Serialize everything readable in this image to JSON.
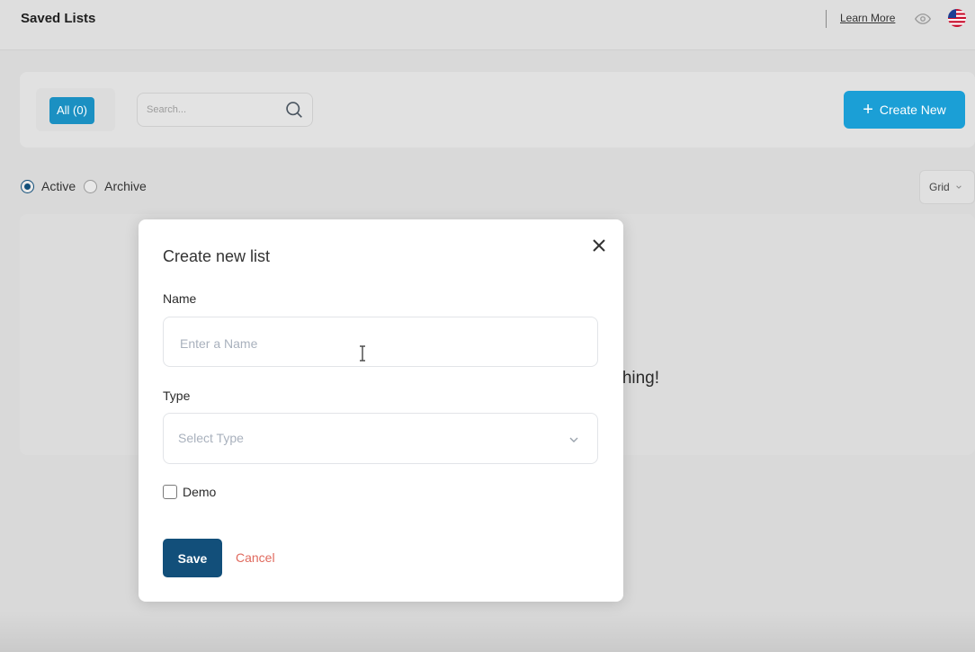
{
  "header": {
    "title": "Saved Lists",
    "learn_more": "Learn More",
    "icons": [
      "eye-icon",
      "us-flag-icon"
    ]
  },
  "toolbar": {
    "all_pill": "All (0)",
    "search_placeholder": "Search...",
    "create_new_label": "Create New",
    "accent": "#1b9fd6"
  },
  "filter": {
    "options": [
      {
        "label": "Active",
        "checked": true
      },
      {
        "label": "Archive",
        "checked": false
      }
    ],
    "view_select": "Grid"
  },
  "empty_state": {
    "text_fragment": "rching!"
  },
  "modal": {
    "title": "Create new list",
    "name_label": "Name",
    "name_placeholder": "Enter a Name",
    "name_value": "",
    "type_label": "Type",
    "type_placeholder": "Select Type",
    "demo_label": "Demo",
    "demo_checked": false,
    "save_label": "Save",
    "cancel_label": "Cancel",
    "colors": {
      "primary": "#124f7a",
      "cancel": "#e06a5e"
    }
  }
}
